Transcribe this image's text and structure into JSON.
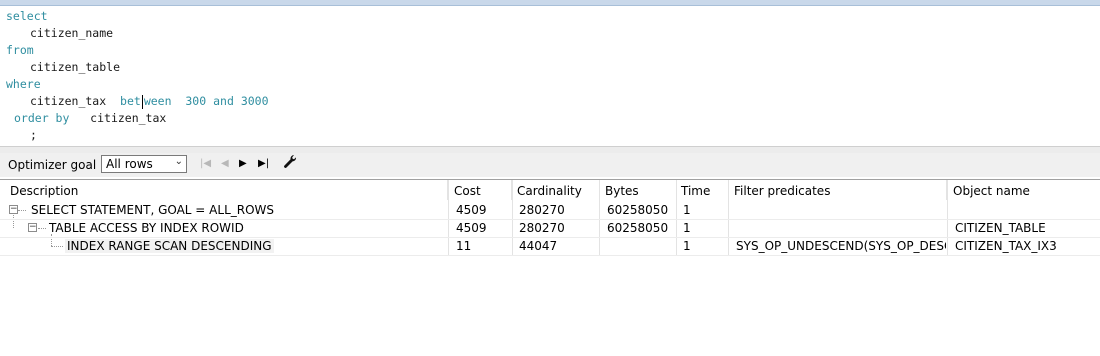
{
  "editor": {
    "lines": [
      {
        "t1": "select"
      },
      {
        "t1": "citizen_name"
      },
      {
        "t1": "from"
      },
      {
        "t1": "citizen_table"
      },
      {
        "t1": "where"
      },
      {
        "t1": "citizen_tax",
        "t2a": "bet",
        "t2b": "ween",
        "t3": "300",
        "t4": "and",
        "t5": "3000"
      },
      {
        "t1": "order by",
        "t2": "citizen_tax"
      },
      {
        "t1": ";"
      }
    ]
  },
  "toolbar": {
    "optimizer_label": "Optimizer goal",
    "optimizer_value": "All rows",
    "first_icon": "first-icon",
    "prev_icon": "previous-icon",
    "next_icon": "next-icon",
    "last_icon": "last-icon",
    "settings_icon": "wrench-icon"
  },
  "grid": {
    "columns": [
      "Description",
      "Cost",
      "Cardinality",
      "Bytes",
      "Time",
      "Filter predicates",
      "Object name"
    ],
    "rows": [
      {
        "description": "SELECT STATEMENT, GOAL = ALL_ROWS",
        "cost": "4509",
        "cardinality": "280270",
        "bytes": "60258050",
        "time": "1",
        "filter": "",
        "object": ""
      },
      {
        "description": "TABLE ACCESS BY INDEX ROWID",
        "cost": "4509",
        "cardinality": "280270",
        "bytes": "60258050",
        "time": "1",
        "filter": "",
        "object": "CITIZEN_TABLE"
      },
      {
        "description": "INDEX RANGE SCAN DESCENDING",
        "cost": "11",
        "cardinality": "44047",
        "bytes": "",
        "time": "1",
        "filter": "SYS_OP_UNDESCEND(SYS_OP_DESCE...",
        "object": "CITIZEN_TAX_IX3"
      }
    ]
  }
}
